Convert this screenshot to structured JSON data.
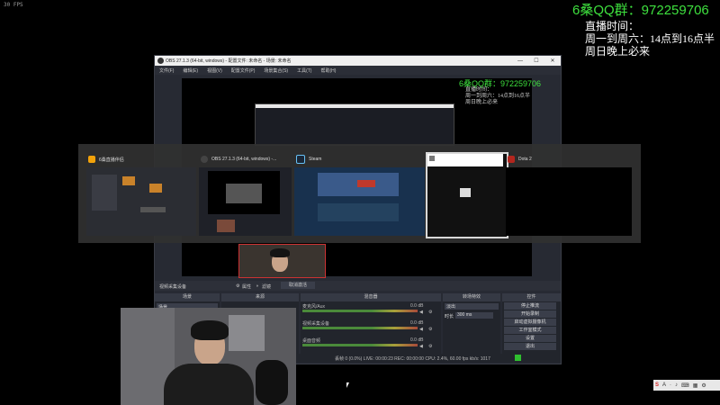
{
  "overlay": {
    "fps": "30 FPS",
    "qq_group": "6桑QQ群：972259706",
    "schedule": [
      "直播时间：",
      "周一到周六：14点到16点半",
      "周日晚上必来"
    ]
  },
  "obs": {
    "title": "OBS 27.1.3 (64-bit, windows) - 配置文件: 未命名 - 场景: 未命名",
    "menu": [
      "文件(F)",
      "编辑(E)",
      "视图(V)",
      "配置文件(P)",
      "场景集合(S)",
      "工具(T)",
      "帮助(H)"
    ],
    "toolbar": {
      "source_label": "视频采集设备",
      "properties": "属性",
      "filters": "滤镜",
      "deactivate": "取消激活"
    },
    "panels": {
      "scenes": "场景",
      "sources": "来源",
      "mixer": "混音器",
      "transitions": "转场特效",
      "controls": "控件"
    },
    "scene_item": "场景",
    "mixer_tracks": [
      {
        "name": "麦克风/Aux",
        "db": "0.0 dB"
      },
      {
        "name": "视频采集设备",
        "db": "0.0 dB"
      },
      {
        "name": "桌面音频",
        "db": "0.0 dB"
      }
    ],
    "transition": {
      "type": "淡出",
      "duration_label": "时长",
      "duration": "300 ms"
    },
    "controls": [
      "停止推流",
      "开始录制",
      "启动虚拟摄像机",
      "工作室模式",
      "设置",
      "退出"
    ],
    "status": "丢帧 0 (0.0%)   LIVE: 00:00:23   REC: 00:00:00   CPU: 2.4%, 60.00 fps   kb/s: 1017"
  },
  "switcher": {
    "windows": [
      {
        "title": "6桑直播伴侣",
        "icon_color": "#f2a20a"
      },
      {
        "title": "OBS 27.1.3 (64-bit, windows) -...",
        "icon_color": "#444444"
      },
      {
        "title": "Steam",
        "icon_color": "#1b2838"
      },
      {
        "title": "",
        "icon_color": "#777777"
      },
      {
        "title": "Dota 2",
        "icon_color": "#b3261e"
      }
    ]
  },
  "tray": {
    "items": [
      "S",
      "A",
      "·",
      "♪",
      "⌨",
      "▦",
      "⚙"
    ]
  }
}
